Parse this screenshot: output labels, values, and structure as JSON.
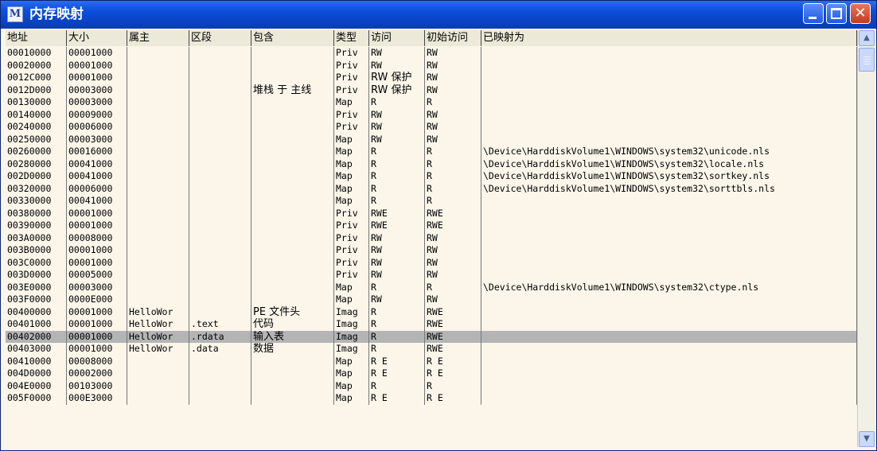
{
  "window": {
    "title": "内存映射",
    "icon_letter": "M",
    "icon": "app-m-icon"
  },
  "controls": {
    "minimize_icon": "minimize-icon",
    "maximize_icon": "maximize-icon",
    "close_icon": "close-icon",
    "close_glyph": "✕",
    "scroll_up_glyph": "▲",
    "scroll_down_glyph": "▼"
  },
  "columns": [
    "地址",
    "大小",
    "属主",
    "区段",
    "包含",
    "类型",
    "访问",
    "初始访问",
    "已映射为"
  ],
  "rows": [
    [
      "00010000",
      "00001000",
      "",
      "",
      "",
      "Priv",
      "RW",
      "RW",
      ""
    ],
    [
      "00020000",
      "00001000",
      "",
      "",
      "",
      "Priv",
      "RW",
      "RW",
      ""
    ],
    [
      "0012C000",
      "00001000",
      "",
      "",
      "",
      "Priv",
      "RW  保护",
      "RW",
      ""
    ],
    [
      "0012D000",
      "00003000",
      "",
      "",
      "堆栈 于 主线",
      "Priv",
      "RW  保护",
      "RW",
      ""
    ],
    [
      "00130000",
      "00003000",
      "",
      "",
      "",
      "Map",
      "R",
      "R",
      ""
    ],
    [
      "00140000",
      "00009000",
      "",
      "",
      "",
      "Priv",
      "RW",
      "RW",
      ""
    ],
    [
      "00240000",
      "00006000",
      "",
      "",
      "",
      "Priv",
      "RW",
      "RW",
      ""
    ],
    [
      "00250000",
      "00003000",
      "",
      "",
      "",
      "Map",
      "RW",
      "RW",
      ""
    ],
    [
      "00260000",
      "00016000",
      "",
      "",
      "",
      "Map",
      "R",
      "R",
      "\\Device\\HarddiskVolume1\\WINDOWS\\system32\\unicode.nls"
    ],
    [
      "00280000",
      "00041000",
      "",
      "",
      "",
      "Map",
      "R",
      "R",
      "\\Device\\HarddiskVolume1\\WINDOWS\\system32\\locale.nls"
    ],
    [
      "002D0000",
      "00041000",
      "",
      "",
      "",
      "Map",
      "R",
      "R",
      "\\Device\\HarddiskVolume1\\WINDOWS\\system32\\sortkey.nls"
    ],
    [
      "00320000",
      "00006000",
      "",
      "",
      "",
      "Map",
      "R",
      "R",
      "\\Device\\HarddiskVolume1\\WINDOWS\\system32\\sorttbls.nls"
    ],
    [
      "00330000",
      "00041000",
      "",
      "",
      "",
      "Map",
      "R",
      "R",
      ""
    ],
    [
      "00380000",
      "00001000",
      "",
      "",
      "",
      "Priv",
      "RWE",
      "RWE",
      ""
    ],
    [
      "00390000",
      "00001000",
      "",
      "",
      "",
      "Priv",
      "RWE",
      "RWE",
      ""
    ],
    [
      "003A0000",
      "00008000",
      "",
      "",
      "",
      "Priv",
      "RW",
      "RW",
      ""
    ],
    [
      "003B0000",
      "00001000",
      "",
      "",
      "",
      "Priv",
      "RW",
      "RW",
      ""
    ],
    [
      "003C0000",
      "00001000",
      "",
      "",
      "",
      "Priv",
      "RW",
      "RW",
      ""
    ],
    [
      "003D0000",
      "00005000",
      "",
      "",
      "",
      "Priv",
      "RW",
      "RW",
      ""
    ],
    [
      "003E0000",
      "00003000",
      "",
      "",
      "",
      "Map",
      "R",
      "R",
      "\\Device\\HarddiskVolume1\\WINDOWS\\system32\\ctype.nls"
    ],
    [
      "003F0000",
      "0000E000",
      "",
      "",
      "",
      "Map",
      "RW",
      "RW",
      ""
    ],
    [
      "00400000",
      "00001000",
      "HelloWor",
      "",
      "PE 文件头",
      "Imag",
      "R",
      "RWE",
      ""
    ],
    [
      "00401000",
      "00001000",
      "HelloWor",
      ".text",
      "代码",
      "Imag",
      "R",
      "RWE",
      ""
    ],
    [
      "00402000",
      "00001000",
      "HelloWor",
      ".rdata",
      "输入表",
      "Imag",
      "R",
      "RWE",
      ""
    ],
    [
      "00403000",
      "00001000",
      "HelloWor",
      ".data",
      "数据",
      "Imag",
      "R",
      "RWE",
      ""
    ],
    [
      "00410000",
      "00008000",
      "",
      "",
      "",
      "Map",
      "R E",
      "R E",
      ""
    ],
    [
      "004D0000",
      "00002000",
      "",
      "",
      "",
      "Map",
      "R E",
      "R E",
      ""
    ],
    [
      "004E0000",
      "00103000",
      "",
      "",
      "",
      "Map",
      "R",
      "R",
      ""
    ],
    [
      "005F0000",
      "000E3000",
      "",
      "",
      "",
      "Map",
      "R E",
      "R E",
      ""
    ]
  ],
  "selected_row": 23
}
